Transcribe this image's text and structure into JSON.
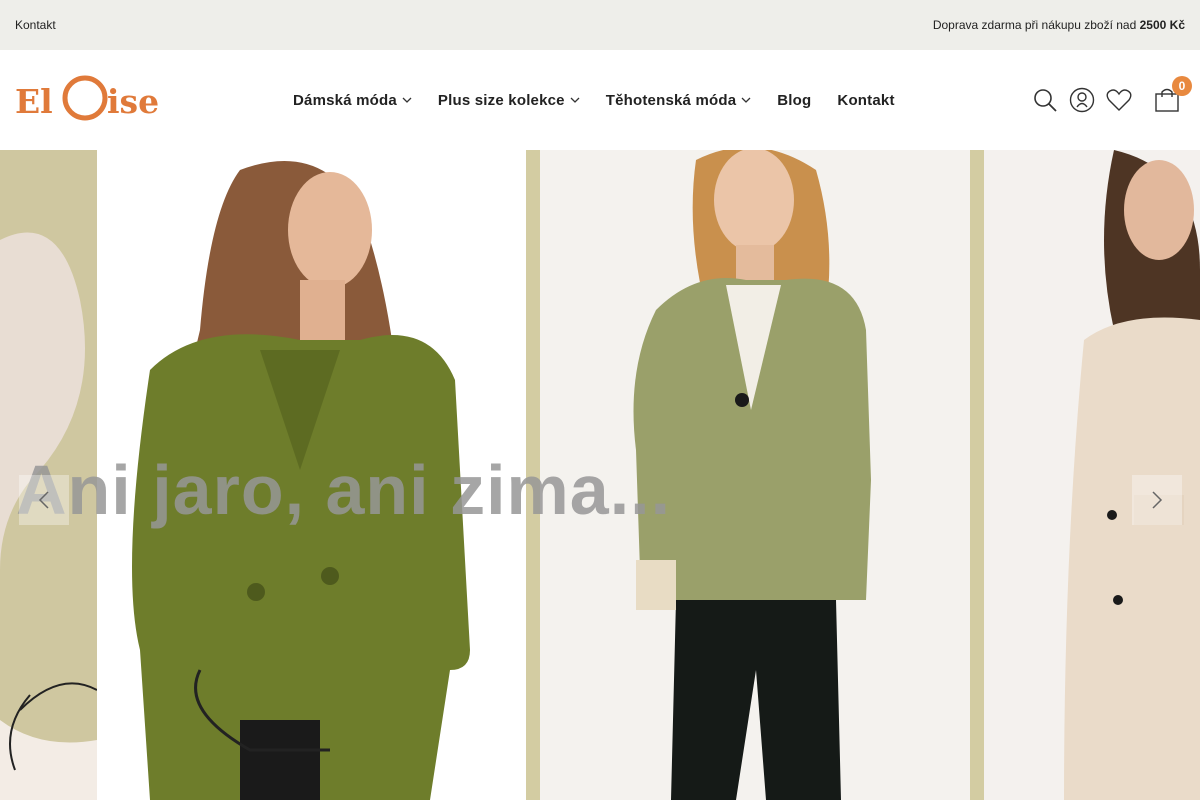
{
  "topbar": {
    "contact_link": "Kontakt",
    "shipping_text": "Doprava zdarma při nákupu zboží nad ",
    "shipping_amount": "2500 Kč"
  },
  "logo": {
    "text": "Eloise",
    "color": "#e07a3a"
  },
  "nav": {
    "items": [
      {
        "label": "Dámská móda",
        "has_dropdown": true
      },
      {
        "label": "Plus size kolekce",
        "has_dropdown": true
      },
      {
        "label": "Těhotenská móda",
        "has_dropdown": true
      },
      {
        "label": "Blog",
        "has_dropdown": false
      },
      {
        "label": "Kontakt",
        "has_dropdown": false
      }
    ]
  },
  "header_icons": {
    "search": "search-icon",
    "account": "user-icon",
    "wishlist": "heart-icon",
    "cart": "cart-icon",
    "cart_count": "0"
  },
  "hero": {
    "title": "Ani jaro, ani zima...",
    "prev": "chevron-left-icon",
    "next": "chevron-right-icon"
  },
  "colors": {
    "accent": "#e8893f",
    "topbar_bg": "#eeeeea",
    "olive": "#6e7d2b",
    "khaki": "#9aa06a"
  }
}
